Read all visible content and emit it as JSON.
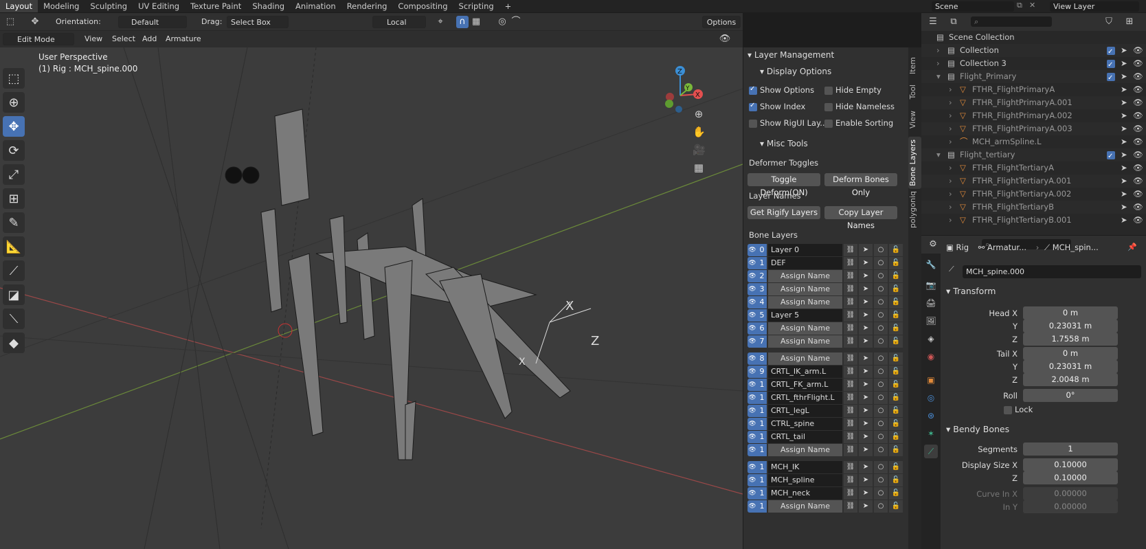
{
  "workspaces": [
    "Layout",
    "Modeling",
    "Sculpting",
    "UV Editing",
    "Texture Paint",
    "Shading",
    "Animation",
    "Rendering",
    "Compositing",
    "Scripting"
  ],
  "scene": {
    "name": "Scene",
    "view_layer": "View Layer"
  },
  "viewport": {
    "orientation_label": "Orientation:",
    "orientation_value": "Default",
    "drag_label": "Drag:",
    "drag_value": "Select Box",
    "pivot_value": "Local",
    "options_label": "Options",
    "mode": "Edit Mode",
    "menus": [
      "View",
      "Select",
      "Add",
      "Armature"
    ],
    "overlay_title": "User Perspective",
    "overlay_object": "(1) Rig : MCH_spine.000",
    "gizmo": {
      "x": "X",
      "y": "Y",
      "z": "Z"
    }
  },
  "npanel": {
    "tabs": [
      "Item",
      "Tool",
      "View",
      "Bone Layers",
      "polygoniq"
    ],
    "layer_management": "Layer Management",
    "display_options": "Display Options",
    "checks": [
      {
        "label": "Show Options",
        "on": true
      },
      {
        "label": "Hide Empty",
        "on": false
      },
      {
        "label": "Show Index",
        "on": true
      },
      {
        "label": "Hide Nameless",
        "on": false
      },
      {
        "label": "Show RigUI Lay...",
        "on": false
      },
      {
        "label": "Enable Sorting",
        "on": false
      }
    ],
    "misc_tools": "Misc Tools",
    "deformer_toggles": "Deformer Toggles",
    "toggle_deform": "Toggle Deform(ON)",
    "deform_only": "Deform Bones Only",
    "layer_names": "Layer Names",
    "get_rigify": "Get Rigify Layers",
    "copy_names": "Copy Layer Names",
    "bone_layers": "Bone Layers",
    "layers": [
      {
        "num": "0",
        "name": "Layer 0",
        "assign": false
      },
      {
        "num": "1",
        "name": "DEF",
        "assign": false
      },
      {
        "num": "2",
        "name": "Assign Name",
        "assign": true
      },
      {
        "num": "3",
        "name": "Assign Name",
        "assign": true
      },
      {
        "num": "4",
        "name": "Assign Name",
        "assign": true
      },
      {
        "num": "5",
        "name": "Layer 5",
        "assign": false
      },
      {
        "num": "6",
        "name": "Assign Name",
        "assign": true
      },
      {
        "num": "7",
        "name": "Assign Name",
        "assign": true
      },
      {
        "num": "8",
        "name": "Assign Name",
        "assign": true
      },
      {
        "num": "9",
        "name": "CRTL_IK_arm.L",
        "assign": false
      },
      {
        "num": "1",
        "name": "CRTL_FK_arm.L",
        "assign": false
      },
      {
        "num": "1",
        "name": "CRTL_fthrFlight.L",
        "assign": false
      },
      {
        "num": "1",
        "name": "CRTL_legL",
        "assign": false
      },
      {
        "num": "1",
        "name": "CTRL_spine",
        "assign": false
      },
      {
        "num": "1",
        "name": "CRTL_tail",
        "assign": false
      },
      {
        "num": "1",
        "name": "Assign Name",
        "assign": true
      },
      {
        "num": "1",
        "name": "MCH_IK",
        "assign": false
      },
      {
        "num": "1",
        "name": "MCH_spline",
        "assign": false
      },
      {
        "num": "1",
        "name": "MCH_neck",
        "assign": false
      },
      {
        "num": "1",
        "name": "Assign Name",
        "assign": true
      }
    ]
  },
  "outliner": {
    "rows": [
      {
        "label": "Scene Collection",
        "indent": 0,
        "kind": "coll"
      },
      {
        "label": "Collection",
        "indent": 1,
        "kind": "coll"
      },
      {
        "label": "Collection 3",
        "indent": 1,
        "kind": "coll"
      },
      {
        "label": "Flight_Primary",
        "indent": 1,
        "kind": "coll",
        "dim": true
      },
      {
        "label": "FTHR_FlightPrimaryA",
        "indent": 2,
        "kind": "obj",
        "dim": true
      },
      {
        "label": "FTHR_FlightPrimaryA.001",
        "indent": 2,
        "kind": "obj",
        "dim": true
      },
      {
        "label": "FTHR_FlightPrimaryA.002",
        "indent": 2,
        "kind": "obj",
        "dim": true
      },
      {
        "label": "FTHR_FlightPrimaryA.003",
        "indent": 2,
        "kind": "obj",
        "dim": true
      },
      {
        "label": "MCH_armSpline.L",
        "indent": 2,
        "kind": "curve",
        "dim": true
      },
      {
        "label": "Flight_tertiary",
        "indent": 1,
        "kind": "coll",
        "dim": true
      },
      {
        "label": "FTHR_FlightTertiaryA",
        "indent": 2,
        "kind": "obj",
        "dim": true
      },
      {
        "label": "FTHR_FlightTertiaryA.001",
        "indent": 2,
        "kind": "obj",
        "dim": true
      },
      {
        "label": "FTHR_FlightTertiaryA.002",
        "indent": 2,
        "kind": "obj",
        "dim": true
      },
      {
        "label": "FTHR_FlightTertiaryB",
        "indent": 2,
        "kind": "obj",
        "dim": true
      },
      {
        "label": "FTHR_FlightTertiaryB.001",
        "indent": 2,
        "kind": "obj",
        "dim": true
      }
    ]
  },
  "properties": {
    "breadcrumb": [
      "Rig",
      "Armatur...",
      "MCH_spin..."
    ],
    "bone_name": "MCH_spine.000",
    "transform": "Transform",
    "fields": [
      {
        "label": "Head X",
        "value": "0 m"
      },
      {
        "label": "Y",
        "value": "0.23031 m"
      },
      {
        "label": "Z",
        "value": "1.7558 m"
      },
      {
        "label": "Tail X",
        "value": "0 m"
      },
      {
        "label": "Y",
        "value": "0.23031 m"
      },
      {
        "label": "Z",
        "value": "2.0048 m"
      },
      {
        "label": "Roll",
        "value": "0°"
      }
    ],
    "lock": "Lock",
    "bendy": "Bendy Bones",
    "bendy_fields": [
      {
        "label": "Segments",
        "value": "1"
      },
      {
        "label": "Display Size X",
        "value": "0.10000"
      },
      {
        "label": "Z",
        "value": "0.10000"
      },
      {
        "label": "Curve In X",
        "value": "0.00000"
      },
      {
        "label": "In Y",
        "value": "0.00000"
      }
    ]
  }
}
